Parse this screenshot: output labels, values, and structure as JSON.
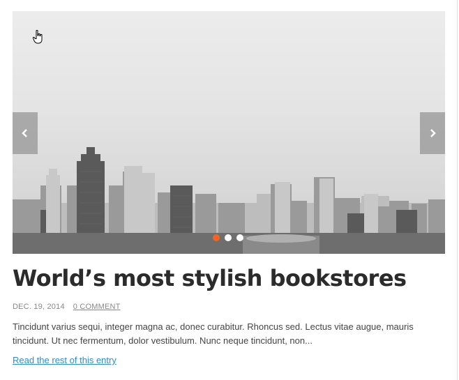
{
  "slider": {
    "image_alt": "city-skyline-photo",
    "prev_icon": "chevron-left-icon",
    "next_icon": "chevron-right-icon",
    "dots": [
      {
        "active": true
      },
      {
        "active": false
      },
      {
        "active": false
      }
    ],
    "active_dot_color": "#f26522"
  },
  "post": {
    "title": "World’s most stylish bookstores",
    "date": "DEC. 19, 2014",
    "comments": "0 COMMENT",
    "excerpt": "Tincidunt varius sequi, integer magna ac, donec curabitur. Rhoncus sed. Lectus vitae augue, mauris tincidunt. Ut nec fermentum, dolor vestibulum. Nunc neque tincidunt, non...",
    "read_more": "Read the rest of this entry"
  },
  "colors": {
    "link": "#2a8fd0",
    "title": "#2b2b2b",
    "meta": "#888888"
  }
}
